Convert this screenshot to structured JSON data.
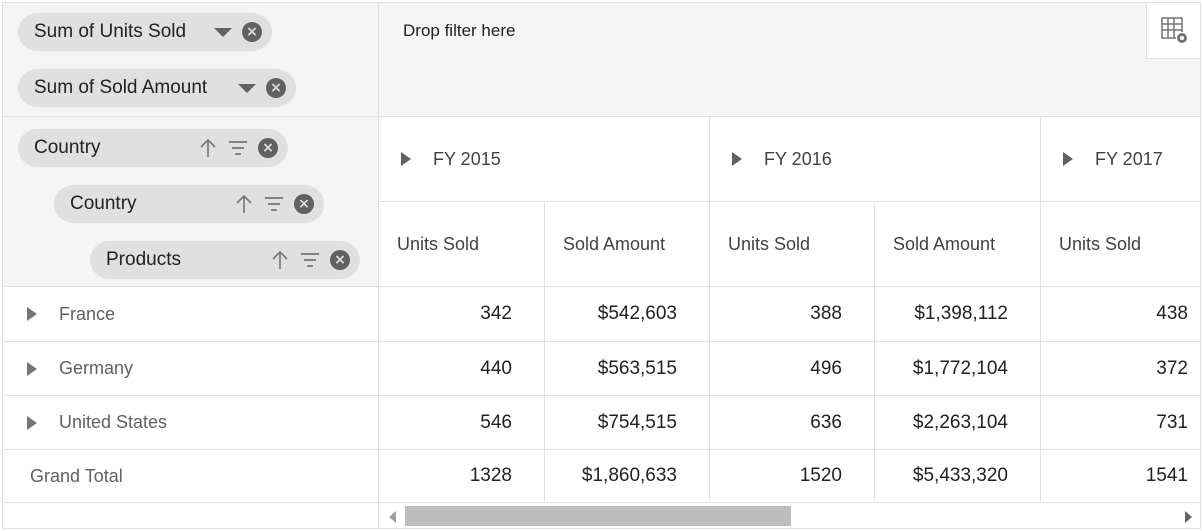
{
  "values_panel": {
    "pills": [
      {
        "label": "Sum of Units Sold"
      },
      {
        "label": "Sum of Sold Amount"
      }
    ]
  },
  "filter_panel": {
    "placeholder": "Drop filter here"
  },
  "row_panel": {
    "pills": [
      {
        "label": "Country"
      },
      {
        "label": "Country"
      },
      {
        "label": "Products"
      }
    ]
  },
  "columns": {
    "years": [
      "FY 2015",
      "FY 2016",
      "FY 2017"
    ],
    "measures": [
      "Units Sold",
      "Sold Amount",
      "Units Sold",
      "Sold Amount",
      "Units Sold"
    ]
  },
  "rows": [
    {
      "label": "France",
      "values": [
        "342",
        "$542,603",
        "388",
        "$1,398,112",
        "438"
      ]
    },
    {
      "label": "Germany",
      "values": [
        "440",
        "$563,515",
        "496",
        "$1,772,104",
        "372"
      ]
    },
    {
      "label": "United States",
      "values": [
        "546",
        "$754,515",
        "636",
        "$2,263,104",
        "731"
      ]
    }
  ],
  "grand_total": {
    "label": "Grand Total",
    "values": [
      "1328",
      "$1,860,633",
      "1520",
      "$5,433,320",
      "1541"
    ]
  },
  "icons": {
    "settings": "grid-settings-icon",
    "sort": "arrow-up-icon",
    "filter": "filter-icon",
    "remove": "close-circle-icon",
    "dropdown": "caret-down-icon",
    "expand": "caret-right-icon"
  }
}
